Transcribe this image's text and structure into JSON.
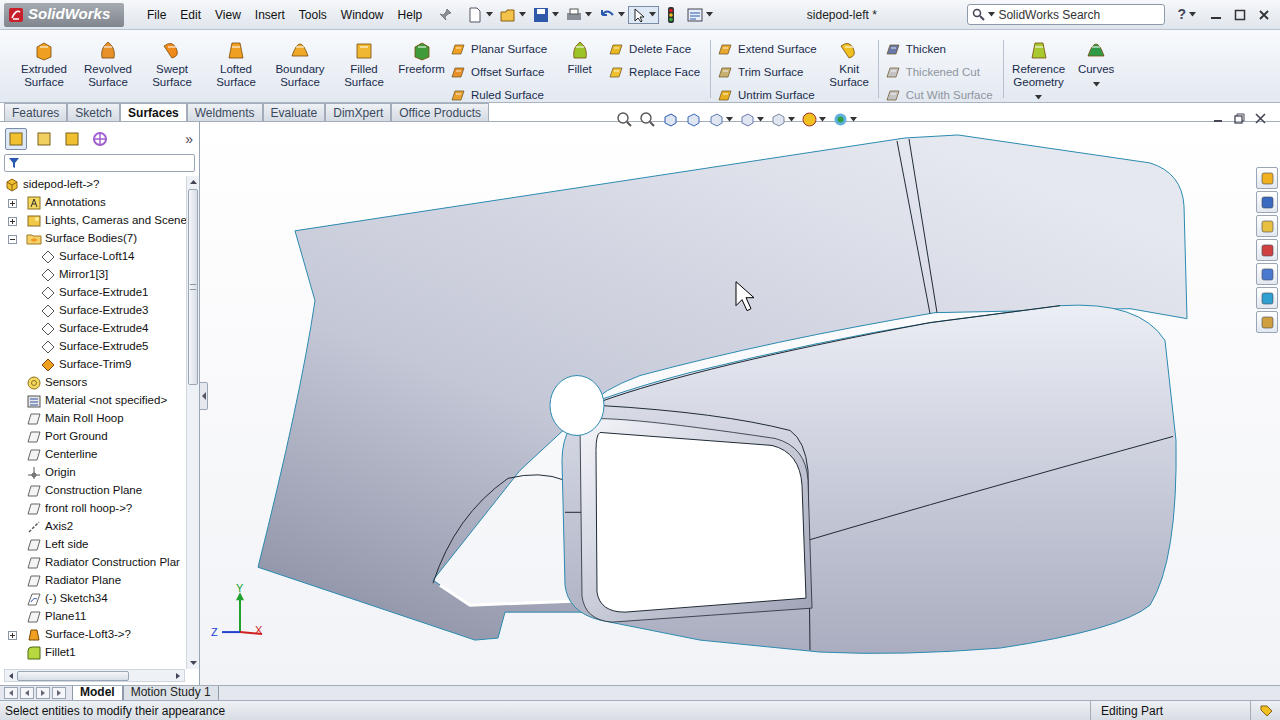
{
  "window": {
    "app": "SolidWorks",
    "title": "sidepod-left *"
  },
  "menu": [
    "File",
    "Edit",
    "View",
    "Insert",
    "Tools",
    "Window",
    "Help"
  ],
  "search": {
    "placeholder": "SolidWorks Search"
  },
  "help": "?",
  "ribbon": [
    {
      "kind": "large",
      "label": "Extruded Surface",
      "disabled": false,
      "dropdown": false
    },
    {
      "kind": "large",
      "label": "Revolved Surface",
      "disabled": false,
      "dropdown": false
    },
    {
      "kind": "large",
      "label": "Swept Surface",
      "disabled": false,
      "dropdown": false
    },
    {
      "kind": "large",
      "label": "Lofted Surface",
      "disabled": false,
      "dropdown": false
    },
    {
      "kind": "large",
      "label": "Boundary Surface",
      "disabled": false,
      "dropdown": false
    },
    {
      "kind": "large",
      "label": "Filled Surface",
      "disabled": false,
      "dropdown": false
    },
    {
      "kind": "large",
      "label": "Freeform",
      "disabled": false,
      "dropdown": false
    },
    {
      "kind": "stack",
      "items": [
        {
          "label": "Planar Surface",
          "disabled": false
        },
        {
          "label": "Offset Surface",
          "disabled": false
        },
        {
          "label": "Ruled Surface",
          "disabled": false
        }
      ]
    },
    {
      "kind": "large",
      "label": "Fillet",
      "disabled": false,
      "dropdown": false
    },
    {
      "kind": "stack",
      "items": [
        {
          "label": "Delete Face",
          "disabled": false
        },
        {
          "label": "Replace Face",
          "disabled": false
        }
      ]
    },
    {
      "kind": "separator"
    },
    {
      "kind": "stack",
      "items": [
        {
          "label": "Extend Surface",
          "disabled": false
        },
        {
          "label": "Trim Surface",
          "disabled": false
        },
        {
          "label": "Untrim Surface",
          "disabled": false
        }
      ]
    },
    {
      "kind": "large",
      "label": "Knit Surface",
      "disabled": false,
      "dropdown": false
    },
    {
      "kind": "separator"
    },
    {
      "kind": "stack",
      "items": [
        {
          "label": "Thicken",
          "disabled": false
        },
        {
          "label": "Thickened Cut",
          "disabled": true
        },
        {
          "label": "Cut With Surface",
          "disabled": true
        }
      ]
    },
    {
      "kind": "separator"
    },
    {
      "kind": "large",
      "label": "Reference Geometry",
      "disabled": false,
      "dropdown": true
    },
    {
      "kind": "large",
      "label": "Curves",
      "disabled": false,
      "dropdown": true
    }
  ],
  "command_tabs": [
    {
      "label": "Features",
      "selected": false
    },
    {
      "label": "Sketch",
      "selected": false
    },
    {
      "label": "Surfaces",
      "selected": true
    },
    {
      "label": "Weldments",
      "selected": false
    },
    {
      "label": "Evaluate",
      "selected": false
    },
    {
      "label": "DimXpert",
      "selected": false
    },
    {
      "label": "Office Products",
      "selected": false
    }
  ],
  "feature_tree": {
    "overflow": "»",
    "items": [
      {
        "label": "sidepod-left->?",
        "depth": 0,
        "kind": "part",
        "expandable": false,
        "expanded": false
      },
      {
        "label": "Annotations",
        "depth": 1,
        "kind": "annotation",
        "expandable": true,
        "expanded": false
      },
      {
        "label": "Lights, Cameras and Scene",
        "depth": 1,
        "kind": "lights",
        "expandable": true,
        "expanded": false
      },
      {
        "label": "Surface Bodies(7)",
        "depth": 1,
        "kind": "folder",
        "expandable": true,
        "expanded": true
      },
      {
        "label": "Surface-Loft14",
        "depth": 2,
        "kind": "body",
        "expandable": false,
        "expanded": false
      },
      {
        "label": "Mirror1[3]",
        "depth": 2,
        "kind": "body",
        "expandable": false,
        "expanded": false
      },
      {
        "label": "Surface-Extrude1",
        "depth": 2,
        "kind": "body",
        "expandable": false,
        "expanded": false
      },
      {
        "label": "Surface-Extrude3",
        "depth": 2,
        "kind": "body",
        "expandable": false,
        "expanded": false
      },
      {
        "label": "Surface-Extrude4",
        "depth": 2,
        "kind": "body",
        "expandable": false,
        "expanded": false
      },
      {
        "label": "Surface-Extrude5",
        "depth": 2,
        "kind": "body",
        "expandable": false,
        "expanded": false
      },
      {
        "label": "Surface-Trim9",
        "depth": 2,
        "kind": "body-active",
        "expandable": false,
        "expanded": false
      },
      {
        "label": "Sensors",
        "depth": 1,
        "kind": "sensor",
        "expandable": false,
        "expanded": false
      },
      {
        "label": "Material <not specified>",
        "depth": 1,
        "kind": "material",
        "expandable": false,
        "expanded": false
      },
      {
        "label": "Main Roll Hoop",
        "depth": 1,
        "kind": "plane",
        "expandable": false,
        "expanded": false
      },
      {
        "label": "Port Ground",
        "depth": 1,
        "kind": "plane",
        "expandable": false,
        "expanded": false
      },
      {
        "label": "Centerline",
        "depth": 1,
        "kind": "plane",
        "expandable": false,
        "expanded": false
      },
      {
        "label": "Origin",
        "depth": 1,
        "kind": "origin",
        "expandable": false,
        "expanded": false
      },
      {
        "label": "Construction Plane",
        "depth": 1,
        "kind": "plane",
        "expandable": false,
        "expanded": false
      },
      {
        "label": "front roll hoop->?",
        "depth": 1,
        "kind": "plane",
        "expandable": false,
        "expanded": false
      },
      {
        "label": "Axis2",
        "depth": 1,
        "kind": "axis",
        "expandable": false,
        "expanded": false
      },
      {
        "label": "Left side",
        "depth": 1,
        "kind": "plane",
        "expandable": false,
        "expanded": false
      },
      {
        "label": "Radiator Construction Plar",
        "depth": 1,
        "kind": "plane",
        "expandable": false,
        "expanded": false
      },
      {
        "label": "Radiator Plane",
        "depth": 1,
        "kind": "plane",
        "expandable": false,
        "expanded": false
      },
      {
        "label": "(-) Sketch34",
        "depth": 1,
        "kind": "sketch",
        "expandable": false,
        "expanded": false
      },
      {
        "label": "Plane11",
        "depth": 1,
        "kind": "plane",
        "expandable": false,
        "expanded": false
      },
      {
        "label": "Surface-Loft3->?",
        "depth": 1,
        "kind": "loft",
        "expandable": true,
        "expanded": false
      },
      {
        "label": "Fillet1",
        "depth": 1,
        "kind": "fillet",
        "expandable": false,
        "expanded": false
      }
    ]
  },
  "triad": {
    "x": "X",
    "y": "Y",
    "z": "Z"
  },
  "bottom_tabs": [
    {
      "label": "Model",
      "selected": true
    },
    {
      "label": "Motion Study 1",
      "selected": false
    }
  ],
  "status_bar": {
    "message": "Select entities to modify their appearance",
    "mode": "Editing Part"
  }
}
